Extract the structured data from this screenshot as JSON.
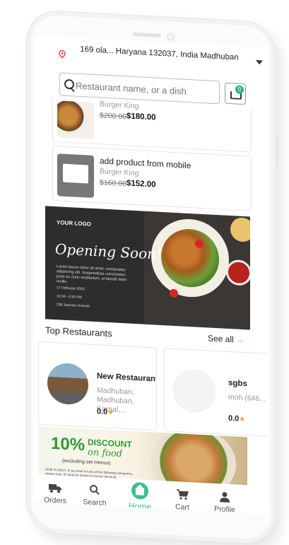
{
  "header": {
    "location": "169 ola... Haryana 132037, India Madhuban"
  },
  "search": {
    "placeholder": "Restaurant name, or a dish",
    "cart_count": "0"
  },
  "products": [
    {
      "name": "",
      "restaurant": "Burger King",
      "old_price": "$200.00",
      "price": "$180.00"
    },
    {
      "name": "add product from mobile",
      "restaurant": "Burger King",
      "old_price": "$160.00",
      "price": "$152.00"
    }
  ],
  "banner": {
    "logo": "YOUR LOGO",
    "title": "Opening Soon!",
    "description": "Lorem ipsum dolor sit amet, consectetur adipiscing elit. Suspendisse consectetur justo eu nunc vestibulum, ut blandit dolor mollis.",
    "date": "17 February 2020",
    "time": "10:30 - 4:30 PM",
    "address": "238 Jasmine Summit"
  },
  "top_restaurants": {
    "title": "Top Restaurants",
    "see_all": "See all",
    "items": [
      {
        "name": "New Restaurants",
        "address": "Madhuban, Madhuban, Karnal,...",
        "rating": "0.0"
      },
      {
        "name": "sgbs",
        "address": "moh (646...",
        "rating": "0.0"
      }
    ]
  },
  "promo": {
    "percent": "10%",
    "discount": "DISCOUNT",
    "on_food": "on food",
    "exclusion": "(excluding set menus)",
    "small_print": "DINE IN ONLY: If you work for any of the following companies, please note, ID must be shown to receive discount."
  },
  "nav": {
    "items": [
      {
        "label": "Orders",
        "icon": "truck-icon"
      },
      {
        "label": "Search",
        "icon": "search-icon"
      },
      {
        "label": "Home",
        "icon": "home-icon",
        "active": true
      },
      {
        "label": "Cart",
        "icon": "cart-icon"
      },
      {
        "label": "Profile",
        "icon": "user-icon"
      }
    ],
    "active_color": "#3cbf8f"
  },
  "colors": {
    "accent": "#3cbf8f",
    "price_strike": "#777777",
    "star": "#f0a020"
  }
}
